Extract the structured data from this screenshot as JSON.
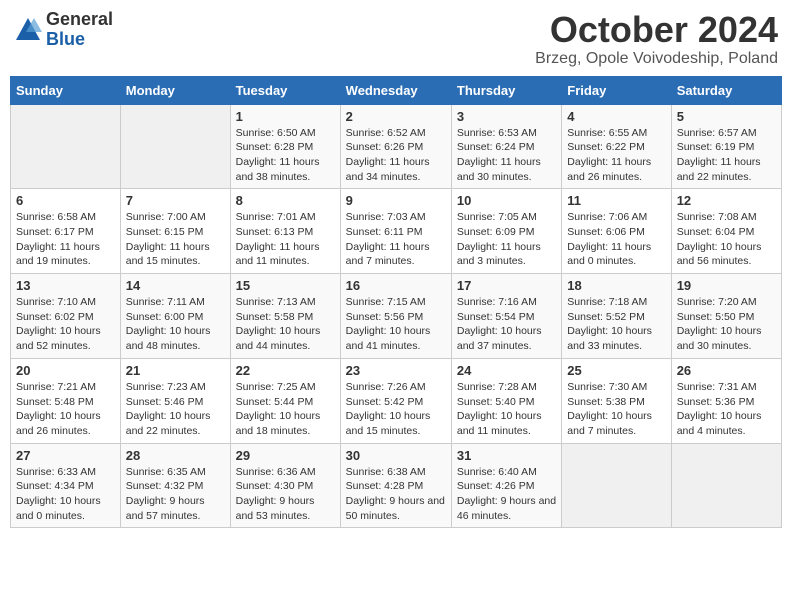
{
  "logo": {
    "general": "General",
    "blue": "Blue"
  },
  "title": "October 2024",
  "location": "Brzeg, Opole Voivodeship, Poland",
  "days_of_week": [
    "Sunday",
    "Monday",
    "Tuesday",
    "Wednesday",
    "Thursday",
    "Friday",
    "Saturday"
  ],
  "weeks": [
    [
      {
        "day": "",
        "info": ""
      },
      {
        "day": "",
        "info": ""
      },
      {
        "day": "1",
        "info": "Sunrise: 6:50 AM\nSunset: 6:28 PM\nDaylight: 11 hours and 38 minutes."
      },
      {
        "day": "2",
        "info": "Sunrise: 6:52 AM\nSunset: 6:26 PM\nDaylight: 11 hours and 34 minutes."
      },
      {
        "day": "3",
        "info": "Sunrise: 6:53 AM\nSunset: 6:24 PM\nDaylight: 11 hours and 30 minutes."
      },
      {
        "day": "4",
        "info": "Sunrise: 6:55 AM\nSunset: 6:22 PM\nDaylight: 11 hours and 26 minutes."
      },
      {
        "day": "5",
        "info": "Sunrise: 6:57 AM\nSunset: 6:19 PM\nDaylight: 11 hours and 22 minutes."
      }
    ],
    [
      {
        "day": "6",
        "info": "Sunrise: 6:58 AM\nSunset: 6:17 PM\nDaylight: 11 hours and 19 minutes."
      },
      {
        "day": "7",
        "info": "Sunrise: 7:00 AM\nSunset: 6:15 PM\nDaylight: 11 hours and 15 minutes."
      },
      {
        "day": "8",
        "info": "Sunrise: 7:01 AM\nSunset: 6:13 PM\nDaylight: 11 hours and 11 minutes."
      },
      {
        "day": "9",
        "info": "Sunrise: 7:03 AM\nSunset: 6:11 PM\nDaylight: 11 hours and 7 minutes."
      },
      {
        "day": "10",
        "info": "Sunrise: 7:05 AM\nSunset: 6:09 PM\nDaylight: 11 hours and 3 minutes."
      },
      {
        "day": "11",
        "info": "Sunrise: 7:06 AM\nSunset: 6:06 PM\nDaylight: 11 hours and 0 minutes."
      },
      {
        "day": "12",
        "info": "Sunrise: 7:08 AM\nSunset: 6:04 PM\nDaylight: 10 hours and 56 minutes."
      }
    ],
    [
      {
        "day": "13",
        "info": "Sunrise: 7:10 AM\nSunset: 6:02 PM\nDaylight: 10 hours and 52 minutes."
      },
      {
        "day": "14",
        "info": "Sunrise: 7:11 AM\nSunset: 6:00 PM\nDaylight: 10 hours and 48 minutes."
      },
      {
        "day": "15",
        "info": "Sunrise: 7:13 AM\nSunset: 5:58 PM\nDaylight: 10 hours and 44 minutes."
      },
      {
        "day": "16",
        "info": "Sunrise: 7:15 AM\nSunset: 5:56 PM\nDaylight: 10 hours and 41 minutes."
      },
      {
        "day": "17",
        "info": "Sunrise: 7:16 AM\nSunset: 5:54 PM\nDaylight: 10 hours and 37 minutes."
      },
      {
        "day": "18",
        "info": "Sunrise: 7:18 AM\nSunset: 5:52 PM\nDaylight: 10 hours and 33 minutes."
      },
      {
        "day": "19",
        "info": "Sunrise: 7:20 AM\nSunset: 5:50 PM\nDaylight: 10 hours and 30 minutes."
      }
    ],
    [
      {
        "day": "20",
        "info": "Sunrise: 7:21 AM\nSunset: 5:48 PM\nDaylight: 10 hours and 26 minutes."
      },
      {
        "day": "21",
        "info": "Sunrise: 7:23 AM\nSunset: 5:46 PM\nDaylight: 10 hours and 22 minutes."
      },
      {
        "day": "22",
        "info": "Sunrise: 7:25 AM\nSunset: 5:44 PM\nDaylight: 10 hours and 18 minutes."
      },
      {
        "day": "23",
        "info": "Sunrise: 7:26 AM\nSunset: 5:42 PM\nDaylight: 10 hours and 15 minutes."
      },
      {
        "day": "24",
        "info": "Sunrise: 7:28 AM\nSunset: 5:40 PM\nDaylight: 10 hours and 11 minutes."
      },
      {
        "day": "25",
        "info": "Sunrise: 7:30 AM\nSunset: 5:38 PM\nDaylight: 10 hours and 7 minutes."
      },
      {
        "day": "26",
        "info": "Sunrise: 7:31 AM\nSunset: 5:36 PM\nDaylight: 10 hours and 4 minutes."
      }
    ],
    [
      {
        "day": "27",
        "info": "Sunrise: 6:33 AM\nSunset: 4:34 PM\nDaylight: 10 hours and 0 minutes."
      },
      {
        "day": "28",
        "info": "Sunrise: 6:35 AM\nSunset: 4:32 PM\nDaylight: 9 hours and 57 minutes."
      },
      {
        "day": "29",
        "info": "Sunrise: 6:36 AM\nSunset: 4:30 PM\nDaylight: 9 hours and 53 minutes."
      },
      {
        "day": "30",
        "info": "Sunrise: 6:38 AM\nSunset: 4:28 PM\nDaylight: 9 hours and 50 minutes."
      },
      {
        "day": "31",
        "info": "Sunrise: 6:40 AM\nSunset: 4:26 PM\nDaylight: 9 hours and 46 minutes."
      },
      {
        "day": "",
        "info": ""
      },
      {
        "day": "",
        "info": ""
      }
    ]
  ]
}
